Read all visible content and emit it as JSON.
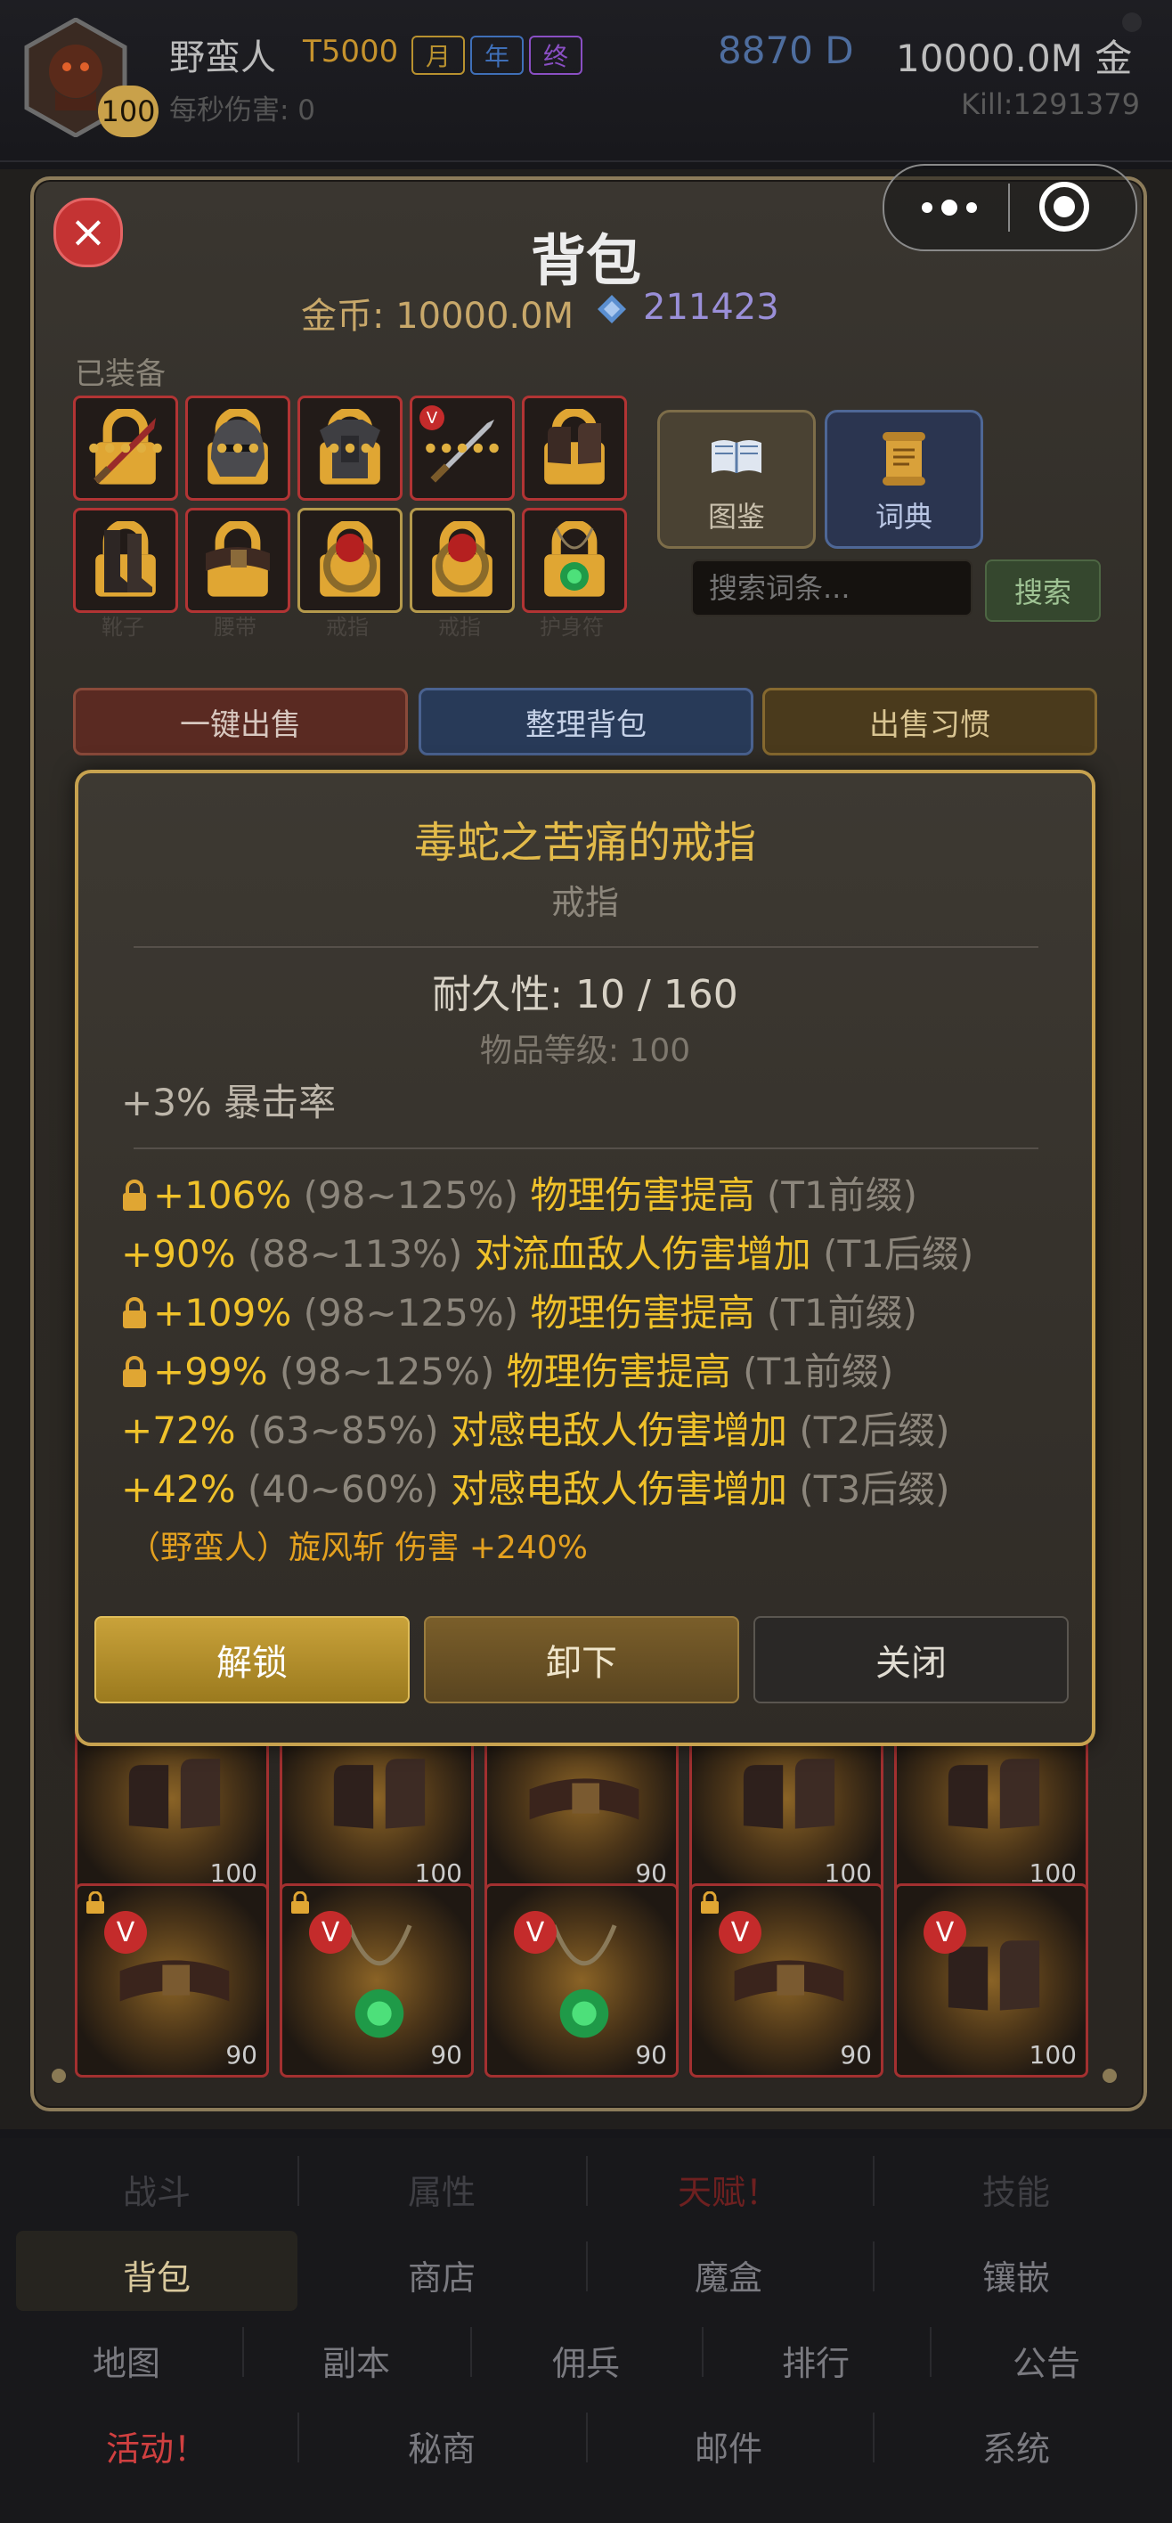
{
  "header": {
    "hero_name": "野蛮人",
    "tier": "T5000",
    "level": "100",
    "tags": [
      {
        "label": "月",
        "color": "#b8912f"
      },
      {
        "label": "年",
        "color": "#3f6fb8"
      },
      {
        "label": "终",
        "color": "#8a4fc4"
      }
    ],
    "dps": "每秒伤害: 0",
    "diamonds": "8870 D",
    "gold": "10000.0M 金",
    "kills": "Kill:1291379"
  },
  "capsule": {
    "more_icon": "more-dots-icon",
    "close_icon": "target-circle-icon"
  },
  "panel": {
    "title": "背包",
    "gold_line": "金币: 10000.0M",
    "gem_count": "211423",
    "equipped_label": "已装备",
    "equipped_row1": [
      {
        "icon": "sword-icon",
        "locked": true
      },
      {
        "icon": "helmet-icon",
        "locked": true
      },
      {
        "icon": "armor-icon",
        "locked": true
      },
      {
        "icon": "blade-icon",
        "locked": false,
        "v_badge": true
      },
      {
        "icon": "gloves-icon",
        "locked": true
      }
    ],
    "equipped_row2": [
      {
        "icon": "boots-icon",
        "locked": true,
        "caption": "靴子"
      },
      {
        "icon": "belt-icon",
        "locked": true,
        "caption": "腰带"
      },
      {
        "icon": "ring-icon",
        "locked": true,
        "caption": "戒指"
      },
      {
        "icon": "ring-icon",
        "locked": true,
        "caption": "戒指"
      },
      {
        "icon": "amulet-icon",
        "locked": true,
        "caption": "护身符"
      }
    ],
    "codex_label": "图鉴",
    "dictionary_label": "词典",
    "search_placeholder": "搜索词条...",
    "search_label": "搜索",
    "sell_all_label": "一键出售",
    "sort_label": "整理背包",
    "sell_habit_label": "出售习惯"
  },
  "inventory": {
    "row_partial": [
      {
        "icon": "gloves-icon",
        "level": "100"
      },
      {
        "icon": "gloves-icon",
        "level": "100"
      },
      {
        "icon": "belt-icon",
        "level": "90"
      },
      {
        "icon": "gloves-icon",
        "level": "100"
      },
      {
        "icon": "gloves-icon",
        "level": "100"
      }
    ],
    "row_full": [
      {
        "icon": "belt-icon",
        "level": "90",
        "locked": true,
        "badge": "V"
      },
      {
        "icon": "amulet-icon",
        "level": "90",
        "locked": true,
        "badge": "V"
      },
      {
        "icon": "amulet-icon",
        "level": "90",
        "locked": false,
        "badge": "V"
      },
      {
        "icon": "belt-icon",
        "level": "90",
        "locked": true,
        "badge": "V"
      },
      {
        "icon": "gloves-icon",
        "level": "100",
        "locked": false,
        "badge": "V"
      }
    ]
  },
  "dialog": {
    "title": "毒蛇之苦痛的戒指",
    "subtitle": "戒指",
    "durability": "耐久性: 10 / 160",
    "item_level": "物品等级: 100",
    "implicit": "+3% 暴击率",
    "affixes": [
      {
        "locked": true,
        "value": "+106%",
        "range": "(98~125%)",
        "name": "物理伤害提高",
        "tier": "(T1前缀)"
      },
      {
        "locked": false,
        "value": "+90%",
        "range": "(88~113%)",
        "name": "对流血敌人伤害增加",
        "tier": "(T1后缀)"
      },
      {
        "locked": true,
        "value": "+109%",
        "range": "(98~125%)",
        "name": "物理伤害提高",
        "tier": "(T1前缀)"
      },
      {
        "locked": true,
        "value": "+99%",
        "range": "(98~125%)",
        "name": "物理伤害提高",
        "tier": "(T1前缀)"
      },
      {
        "locked": false,
        "value": "+72%",
        "range": "(63~85%)",
        "name": "对感电敌人伤害增加",
        "tier": "(T2后缀)"
      },
      {
        "locked": false,
        "value": "+42%",
        "range": "(40~60%)",
        "name": "对感电敌人伤害增加",
        "tier": "(T3后缀)"
      }
    ],
    "skill_line": "（野蛮人）旋风斩 伤害 +240%",
    "unlock_label": "解锁",
    "unequip_label": "卸下",
    "close_label": "关闭"
  },
  "nav": {
    "row1": [
      "战斗",
      "属性",
      "天赋！",
      "技能"
    ],
    "row2": [
      "背包",
      "商店",
      "魔盒",
      "镶嵌"
    ],
    "row3": [
      "地图",
      "副本",
      "佣兵",
      "排行",
      "公告"
    ],
    "row4": [
      "活动！",
      "秘商",
      "邮件",
      "系统"
    ],
    "active": "背包"
  },
  "colors": {
    "accent_gold": "#c7a24f",
    "affix_yellow": "#f0c22a",
    "alert_red": "#c43333"
  }
}
